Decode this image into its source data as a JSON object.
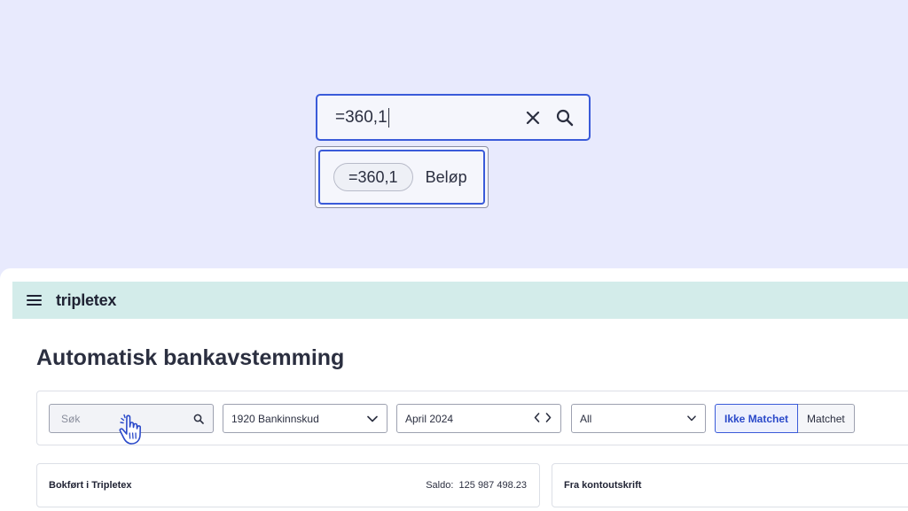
{
  "zoom": {
    "search_value": "=360,1",
    "suggestion": {
      "chip": "=360,1",
      "label": "Beløp"
    }
  },
  "app": {
    "logo": "tripletex",
    "page_title": "Automatisk bankavstemming",
    "filters": {
      "search_placeholder": "Søk",
      "account": "1920 Bankinnskud",
      "period": "April 2024",
      "status": "All",
      "toggle": [
        "Ikke Matchet",
        "Matchet"
      ]
    },
    "cards": {
      "left_title": "Bokført i Tripletex",
      "saldo_label": "Saldo:",
      "saldo_value": "125 987 498.23",
      "right_title": "Fra kontoutskrift"
    }
  },
  "colors": {
    "accent": "#3a5bd9",
    "header_bg": "#d3ecea",
    "backdrop": "#e8eafd"
  }
}
